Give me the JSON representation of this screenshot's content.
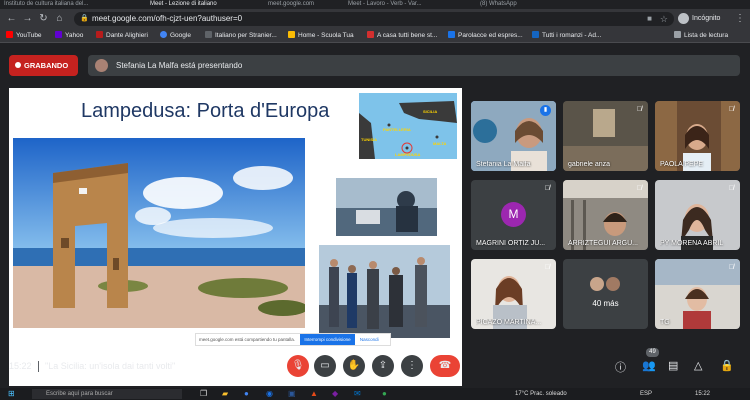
{
  "browser": {
    "tabs": [
      "Instituto de cultura italiana del...",
      "Meet - Lezione di italiano",
      "meet.google.com",
      "Meet - Lavoro - Verb - Var...",
      "(8) WhatsApp"
    ],
    "url": "meet.google.com/ofh-cjzt-uen?authuser=0",
    "profile_label": "Incógnito",
    "bookmarks": [
      {
        "label": "YouTube",
        "color": "#ff0000"
      },
      {
        "label": "Yahoo",
        "color": "#6001d2"
      },
      {
        "label": "Dante Alighieri",
        "color": "#b71c1c"
      },
      {
        "label": "Google",
        "color": "#4285f4"
      },
      {
        "label": "Italiano per Stranier...",
        "color": "#5f6368"
      },
      {
        "label": "Home - Scuola Tua",
        "color": "#fbbc04"
      },
      {
        "label": "A casa tutti bene st...",
        "color": "#d32f2f"
      },
      {
        "label": "Parolacce ed espres...",
        "color": "#1a73e8"
      },
      {
        "label": "Tutti i romanzi - Ad...",
        "color": "#1565c0"
      }
    ],
    "reading_list": "Lista de lectura"
  },
  "meet": {
    "recording_label": "GRABANDO",
    "presenting_text": "Stefania La Malfa está presentando",
    "slide": {
      "title": "Lampedusa: Porta d'Europa",
      "map_labels": [
        "SICILIA",
        "PANTELLERIA",
        "TUNISIA",
        "LAMPEDUSA",
        "MALTA"
      ],
      "share_text": "meet.google.com está compartiendo tu pantalla.",
      "stop_label": "Interrompi condivisione",
      "hide_label": "Nascondi"
    },
    "participants": [
      {
        "name": "Stefania La Malfa",
        "speaking": true
      },
      {
        "name": "gabriele anza",
        "speaking": false
      },
      {
        "name": "PAOLA PEPE",
        "speaking": false
      },
      {
        "name": "MAGRINI ORTIZ JU...",
        "letter": "M",
        "speaking": false
      },
      {
        "name": "ARRIZTEGUI ARGU...",
        "speaking": false
      },
      {
        "name": "PY MORENA ABRIL",
        "speaking": false
      },
      {
        "name": "PICAZO MARTINA...",
        "speaking": false
      },
      {
        "name": "TG",
        "speaking": false
      }
    ],
    "more_label": "40 más",
    "time": "15:22",
    "meeting_title": "\"La Sicilia: un'isola dai tanti volti\"",
    "participant_count": "49"
  },
  "taskbar": {
    "search_placeholder": "Escribe aquí para buscar",
    "weather": "17°C  Prac. soleado",
    "lang": "ESP",
    "time": "15:22"
  }
}
